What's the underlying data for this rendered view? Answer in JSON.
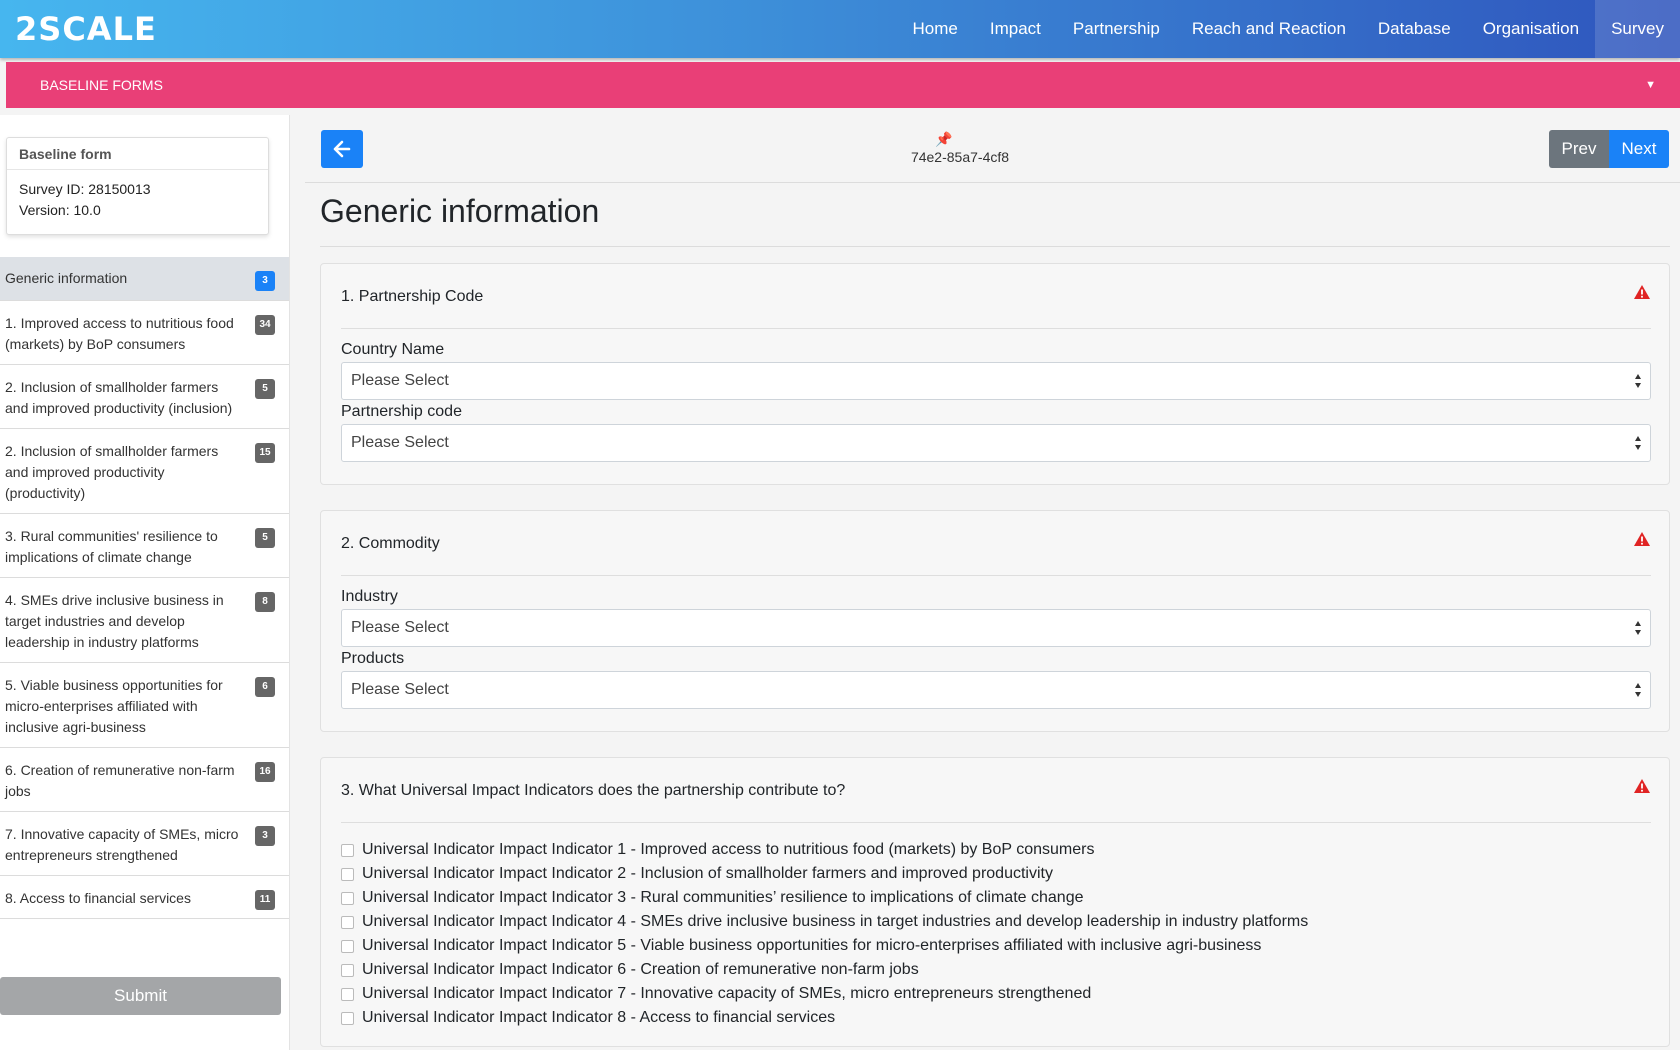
{
  "brand": "2SCALE",
  "nav": {
    "items": [
      {
        "label": "Home"
      },
      {
        "label": "Impact"
      },
      {
        "label": "Partnership"
      },
      {
        "label": "Reach and Reaction"
      },
      {
        "label": "Database"
      },
      {
        "label": "Organisation"
      },
      {
        "label": "Survey",
        "active": true
      }
    ]
  },
  "pinkbar": {
    "title": "BASELINE FORMS"
  },
  "form_card": {
    "title": "Baseline form",
    "survey_id": "Survey ID: 28150013",
    "version": "Version: 10.0"
  },
  "sidebar": {
    "items": [
      {
        "label": "Generic information",
        "badge": "3"
      },
      {
        "label": "1. Improved access to nutritious food (markets) by BoP consumers",
        "badge": "34"
      },
      {
        "label": "2. Inclusion of smallholder farmers and improved productivity (inclusion)",
        "badge": "5"
      },
      {
        "label": "2. Inclusion of smallholder farmers and improved productivity (productivity)",
        "badge": "15"
      },
      {
        "label": "3. Rural communities' resilience to implications of climate change",
        "badge": "5"
      },
      {
        "label": "4. SMEs drive inclusive business in target industries and develop leadership in industry platforms",
        "badge": "8"
      },
      {
        "label": "5. Viable business opportunities for micro-enterprises affiliated with inclusive agri-business",
        "badge": "6"
      },
      {
        "label": "6. Creation of remunerative non-farm jobs",
        "badge": "16"
      },
      {
        "label": "7. Innovative capacity of SMEs, micro entrepreneurs strengthened",
        "badge": "3"
      },
      {
        "label": "8. Access to financial services",
        "badge": "11"
      }
    ],
    "submit_label": "Submit"
  },
  "toolbar": {
    "uuid": "74e2-85a7-4cf8",
    "prev_label": "Prev",
    "next_label": "Next"
  },
  "page_title": "Generic information",
  "questions": {
    "q1": {
      "title": "1. Partnership Code",
      "field1_label": "Country Name",
      "field1_value": "Please Select",
      "field2_label": "Partnership code",
      "field2_value": "Please Select"
    },
    "q2": {
      "title": "2. Commodity",
      "field1_label": "Industry",
      "field1_value": "Please Select",
      "field2_label": "Products",
      "field2_value": "Please Select"
    },
    "q3": {
      "title": "3. What Universal Impact Indicators does the partnership contribute to?",
      "options": [
        "Universal Indicator Impact Indicator 1 - Improved access to nutritious food (markets) by BoP consumers",
        "Universal Indicator Impact Indicator 2 - Inclusion of smallholder farmers and improved productivity",
        "Universal Indicator Impact Indicator 3 - Rural communities’ resilience to implications of climate change",
        "Universal Indicator Impact Indicator 4 - SMEs drive inclusive business in target industries and develop leadership in industry platforms",
        "Universal Indicator Impact Indicator 5 - Viable business opportunities for micro-enterprises affiliated with inclusive agri-business",
        "Universal Indicator Impact Indicator 6 - Creation of remunerative non-farm jobs",
        "Universal Indicator Impact Indicator 7 - Innovative capacity of SMEs, micro entrepreneurs strengthened",
        "Universal Indicator Impact Indicator 8 - Access to financial services"
      ]
    }
  },
  "colors": {
    "nav_gradient_start": "#46b6ef",
    "nav_gradient_end": "#2f55bd",
    "pinkbar": "#e93f77",
    "primary": "#1a82f7",
    "secondary": "#6c757d",
    "warning_icon": "#e02424"
  },
  "icons": {
    "back": "arrow-left-icon",
    "pin": "pin-icon",
    "warning": "warning-triangle-icon",
    "select": "select-arrows-icon",
    "caret": "caret-down-icon"
  }
}
